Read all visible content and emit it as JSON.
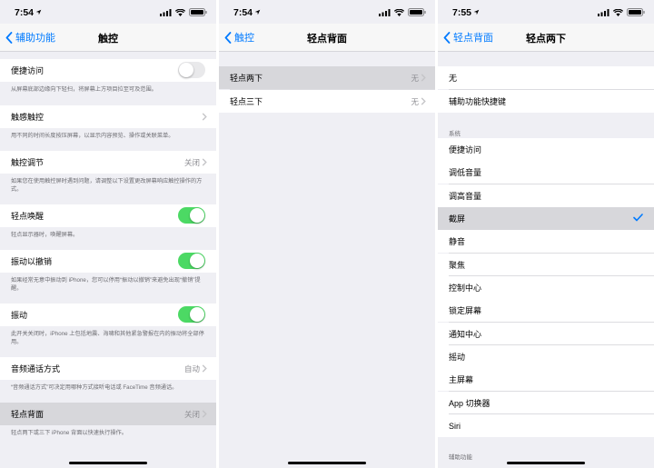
{
  "colors": {
    "accent": "#007aff",
    "toggle_on": "#4cd964",
    "selected_row": "#d7d7db"
  },
  "screen1": {
    "time": "7:54",
    "back_label": "辅助功能",
    "title": "触控",
    "rows": {
      "assistive": {
        "label": "便捷访问",
        "footer": "从屏幕底部边缘向下轻扫，将屏幕上方项目拉至可及范围。",
        "toggle": "off"
      },
      "haptic": {
        "label": "触感触控",
        "footer": "用不同的时间长度按压屏幕，以显示内容预览、操作或关联菜单。"
      },
      "accommodations": {
        "label": "触控调节",
        "value": "关闭",
        "footer": "如果您在使用触控屏时遇到问题，请调整以下设置更改屏幕响应触控操作的方式。"
      },
      "tap_wake": {
        "label": "轻点唤醒",
        "footer": "轻点显示器时，唤醒屏幕。",
        "toggle": "on"
      },
      "shake_undo": {
        "label": "振动以撤销",
        "footer": "如果经常无意中振动到 iPhone，您可以停用“振动以撤销”来避免出现“撤销”提醒。",
        "toggle": "on"
      },
      "vibration": {
        "label": "振动",
        "footer": "此开关关闭时，iPhone 上包括地震、海啸和其他紧急警报在内的振动将全部停用。",
        "toggle": "on"
      },
      "call_audio": {
        "label": "音频通话方式",
        "value": "自动",
        "footer": "“音频通话方式”可决定用哪种方式接听电话或 FaceTime 音频通话。"
      },
      "back_tap": {
        "label": "轻点背面",
        "value": "关闭",
        "footer": "轻点两下或三下 iPhone 背面以快速执行操作。"
      }
    }
  },
  "screen2": {
    "time": "7:54",
    "back_label": "触控",
    "title": "轻点背面",
    "rows": [
      {
        "label": "轻点两下",
        "value": "无"
      },
      {
        "label": "轻点三下",
        "value": "无"
      }
    ]
  },
  "screen3": {
    "time": "7:55",
    "back_label": "轻点背面",
    "title": "轻点两下",
    "top_items": [
      "无",
      "辅助功能快捷键"
    ],
    "system_header": "系统",
    "system_items": [
      "便捷访问",
      "调低音量",
      "调高音量",
      "截屏",
      "静音",
      "聚焦",
      "控制中心",
      "锁定屏幕",
      "通知中心",
      "摇动",
      "主屏幕",
      "App 切换器",
      "Siri"
    ],
    "selected": "截屏",
    "accessibility_header": "辅助功能"
  }
}
